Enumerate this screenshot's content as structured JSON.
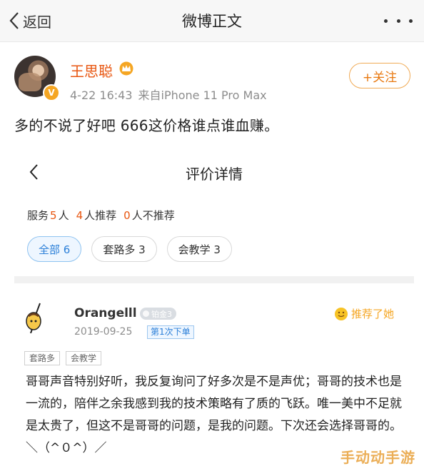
{
  "nav": {
    "back_label": "返回",
    "title": "微博正文"
  },
  "post": {
    "username": "王思聪",
    "time": "4-22 16:43",
    "source": "来自iPhone 11 Pro Max",
    "follow_label": "+关注",
    "text": "多的不说了好吧 666这价格谁点谁血赚。"
  },
  "review": {
    "title": "评价详情",
    "stats": {
      "service_label": "服务",
      "service_count": "5",
      "service_unit": "人",
      "recommend_count": "4",
      "recommend_label": "人推荐",
      "not_recommend_count": "0",
      "not_recommend_label": "人不推荐"
    },
    "filters": [
      {
        "label": "全部 6"
      },
      {
        "label": "套路多 3"
      },
      {
        "label": "会教学 3"
      }
    ],
    "item": {
      "name": "Orangelll",
      "level": "铂金3",
      "recommend_label": "推荐了她",
      "date": "2019-09-25",
      "order_badge": "第1次下单",
      "tags": [
        "套路多",
        "会教学"
      ],
      "body": "哥哥声音特别好听，我反复询问了好多次是不是声优；哥哥的技术也是一流的，陪伴之余我感到我的技术策略有了质的飞跃。唯一美中不足就是太贵了，但这不是哥哥的问题，是我的问题。下次还会选择哥哥的。＼（^０^）／"
    }
  },
  "watermark": "手动动手游",
  "colors": {
    "accent_orange": "#e8550f",
    "link_blue": "#2b7fd8",
    "follow_orange": "#e8780f"
  }
}
